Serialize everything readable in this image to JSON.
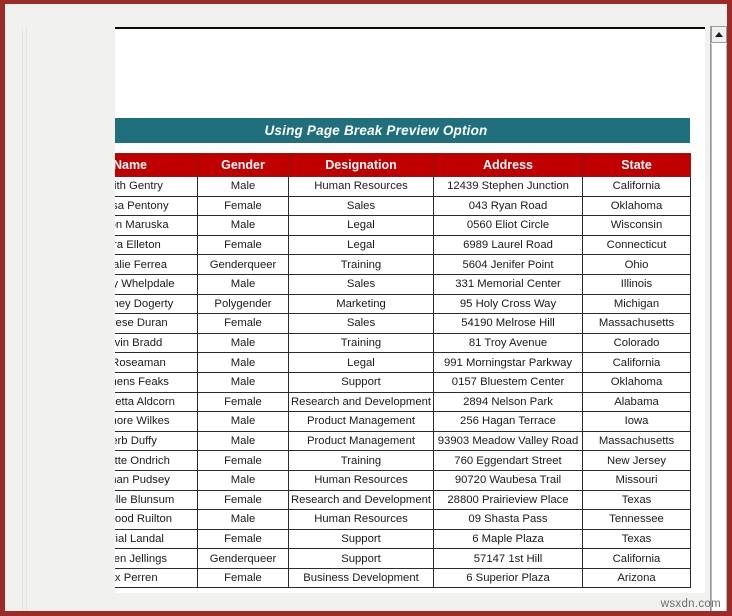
{
  "window": {
    "frame_color": "#9c2b28",
    "workspace_color": "#f1f1f0"
  },
  "scrollbar": {
    "up_arrow_icon": "triangle-up-icon"
  },
  "sheet": {
    "title": "Using Page Break Preview Option",
    "title_bar_color": "#1f6f7c",
    "header_color": "#c00000"
  },
  "table": {
    "columns": [
      "Name",
      "Gender",
      "Designation",
      "Address",
      "State"
    ],
    "rows": [
      [
        "Smith Gentry",
        "Male",
        "Human Resources",
        "12439 Stephen Junction",
        "California"
      ],
      [
        "Dorisa Pentony",
        "Female",
        "Sales",
        "043 Ryan Road",
        "Oklahoma"
      ],
      [
        "Levon Maruska",
        "Male",
        "Legal",
        "0560 Eliot Circle",
        "Wisconsin"
      ],
      [
        "Aura Elleton",
        "Female",
        "Legal",
        "6989 Laurel Road",
        "Connecticut"
      ],
      [
        "Rozalie Ferrea",
        "Genderqueer",
        "Training",
        "5604 Jenifer Point",
        "Ohio"
      ],
      [
        "Donny Whelpdale",
        "Male",
        "Sales",
        "331 Memorial Center",
        "Illinois"
      ],
      [
        "Delainey Dogerty",
        "Polygender",
        "Marketing",
        "95 Holy Cross Way",
        "Michigan"
      ],
      [
        "Therese Duran",
        "Female",
        "Sales",
        "54190 Melrose Hill",
        "Massachusetts"
      ],
      [
        "Calvin Bradd",
        "Male",
        "Training",
        "81 Troy Avenue",
        "Colorado"
      ],
      [
        "Eb Roseaman",
        "Male",
        "Legal",
        "991 Morningstar Parkway",
        "California"
      ],
      [
        "Klemens Feaks",
        "Male",
        "Support",
        "0157 Bluestem Center",
        "Oklahoma"
      ],
      [
        "Jacquetta Aldcorn",
        "Female",
        "Research and Development",
        "2894 Nelson Park",
        "Alabama"
      ],
      [
        "Delmore Wilkes",
        "Male",
        "Product Management",
        "256 Hagan Terrace",
        "Iowa"
      ],
      [
        "Herb Duffy",
        "Male",
        "Product Management",
        "93903 Meadow Valley Road",
        "Massachusetts"
      ],
      [
        "Corette Ondrich",
        "Female",
        "Training",
        "760 Eggendart Street",
        "New Jersey"
      ],
      [
        "Keenan Pudsey",
        "Male",
        "Human Resources",
        "90720 Waubesa Trail",
        "Missouri"
      ],
      [
        "Bernelle Blunsum",
        "Female",
        "Research and Development",
        "28800 Prairieview Place",
        "Texas"
      ],
      [
        "Garwood Ruilton",
        "Male",
        "Human Resources",
        "09 Shasta Pass",
        "Tennessee"
      ],
      [
        "Murial Landal",
        "Female",
        "Support",
        "6 Maple Plaza",
        "Texas"
      ],
      [
        "Dniren Jellings",
        "Genderqueer",
        "Support",
        "57147 1st Hill",
        "California"
      ],
      [
        "Allx Perren",
        "Female",
        "Business Development",
        "6 Superior Plaza",
        "Arizona"
      ]
    ]
  },
  "watermark": {
    "text": "wsxdn.com"
  }
}
